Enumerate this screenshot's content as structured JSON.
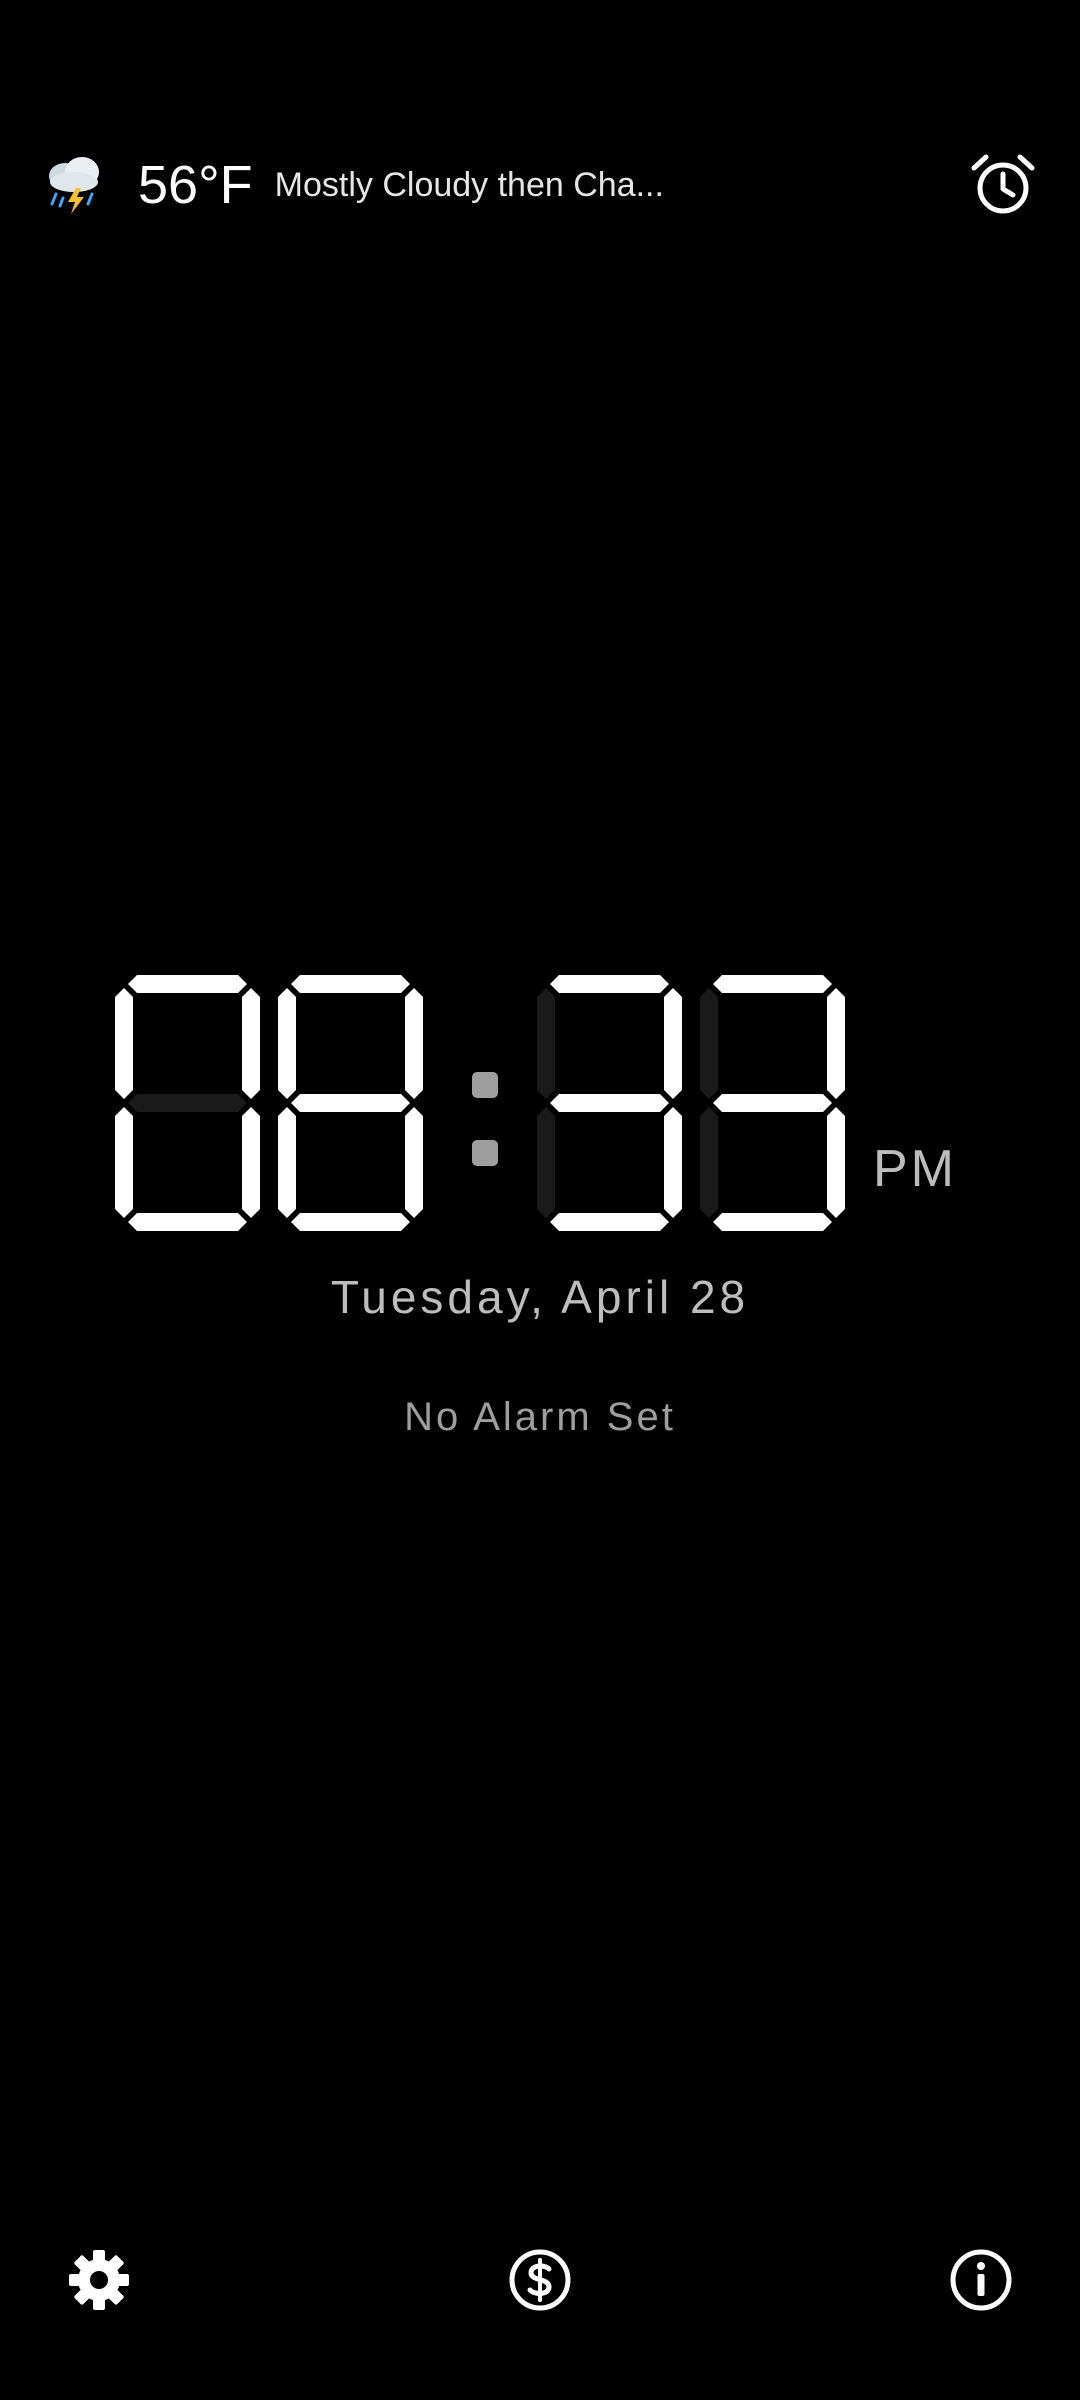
{
  "weather": {
    "icon": "thunderstorm-rain-icon",
    "temperature": "56°F",
    "condition": "Mostly Cloudy then Cha..."
  },
  "toolbar": {
    "alarm_icon": "alarm-clock-icon"
  },
  "clock": {
    "time": "08:33",
    "period": "PM",
    "lit_color": "#ffffff",
    "unlit_color": "#1a1a1a"
  },
  "date": "Tuesday, April 28",
  "alarm_status": "No Alarm Set",
  "bottom_bar": {
    "settings_icon": "gear-icon",
    "premium_icon": "dollar-circle-icon",
    "info_icon": "info-icon"
  }
}
